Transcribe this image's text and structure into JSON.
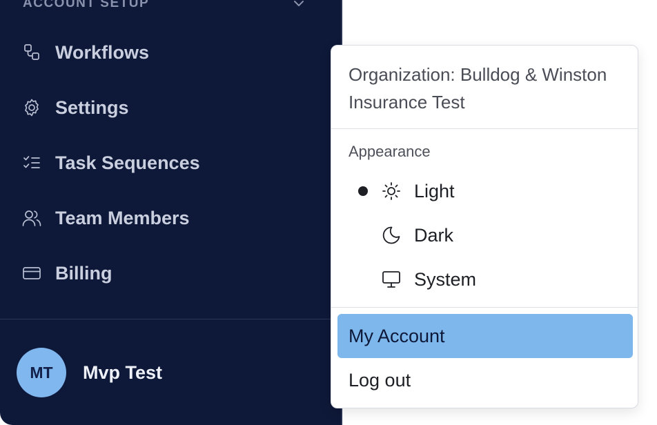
{
  "sidebar": {
    "section_title": "ACCOUNT SETUP",
    "items": [
      {
        "label": "Workflows",
        "icon": "workflow-icon"
      },
      {
        "label": "Settings",
        "icon": "gear-icon"
      },
      {
        "label": "Task Sequences",
        "icon": "checklist-icon"
      },
      {
        "label": "Team Members",
        "icon": "users-icon"
      },
      {
        "label": "Billing",
        "icon": "credit-card-icon"
      }
    ],
    "user": {
      "initials": "MT",
      "name": "Mvp Test"
    }
  },
  "menu": {
    "organization": "Organization: Bulldog & Winston Insurance Test",
    "appearance_label": "Appearance",
    "themes": [
      {
        "label": "Light",
        "icon": "sun-icon",
        "selected": true
      },
      {
        "label": "Dark",
        "icon": "moon-icon",
        "selected": false
      },
      {
        "label": "System",
        "icon": "monitor-icon",
        "selected": false
      }
    ],
    "my_account": "My Account",
    "log_out": "Log out"
  },
  "colors": {
    "sidebar_bg": "#0e1838",
    "highlight": "#7eb7ec",
    "avatar_bg": "#7fb7ee"
  }
}
